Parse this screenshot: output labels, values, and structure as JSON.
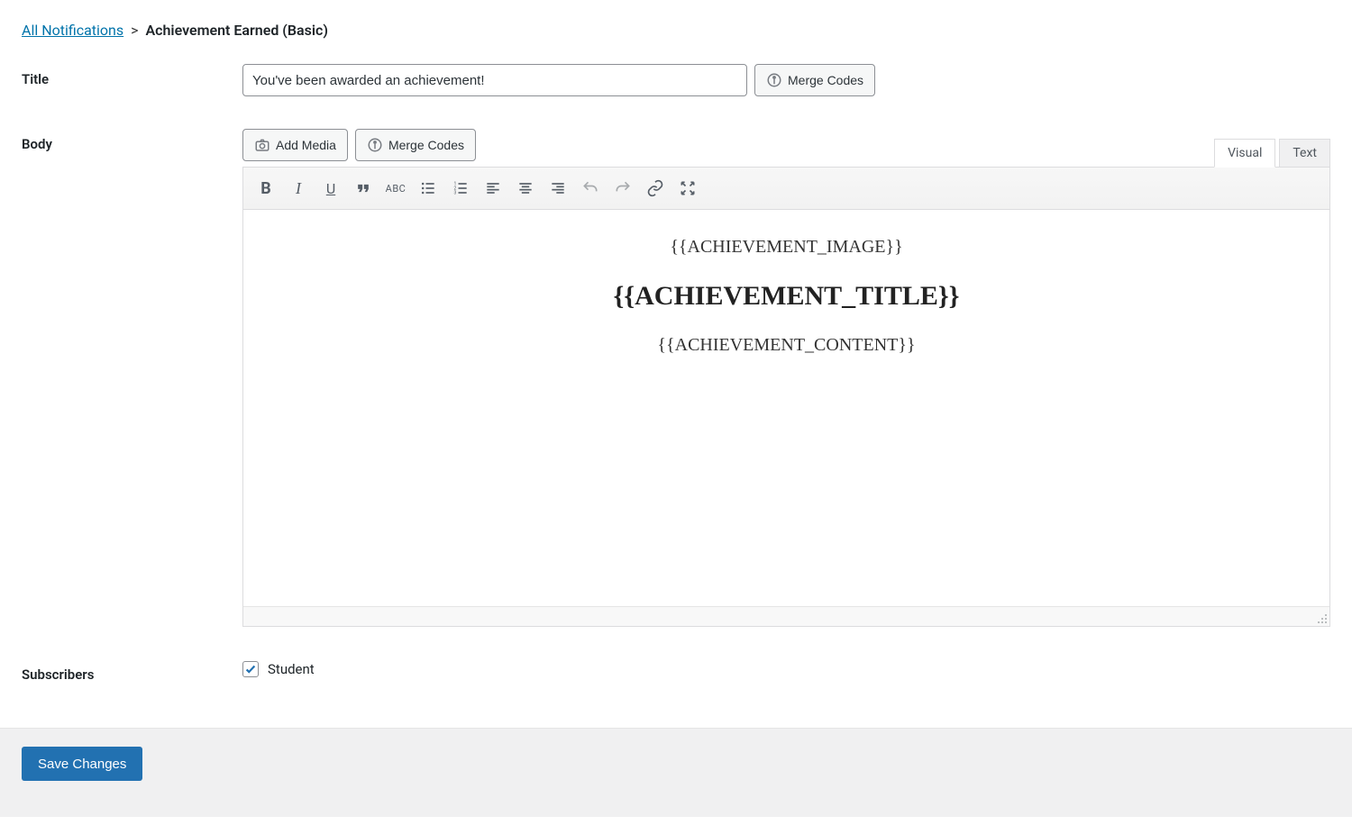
{
  "breadcrumb": {
    "link_label": "All Notifications",
    "separator": ">",
    "current": "Achievement Earned (Basic)"
  },
  "labels": {
    "title": "Title",
    "body": "Body",
    "subscribers": "Subscribers"
  },
  "title_field": {
    "value": "You've been awarded an achievement!"
  },
  "buttons": {
    "merge_codes": "Merge Codes",
    "add_media": "Add Media",
    "save": "Save Changes"
  },
  "editor": {
    "tabs": {
      "visual": "Visual",
      "text": "Text",
      "active": "visual"
    },
    "content": {
      "image": "{{ACHIEVEMENT_IMAGE}}",
      "title": "{{ACHIEVEMENT_TITLE}}",
      "body": "{{ACHIEVEMENT_CONTENT}}"
    }
  },
  "subscribers": {
    "student": {
      "label": "Student",
      "checked": true
    }
  }
}
